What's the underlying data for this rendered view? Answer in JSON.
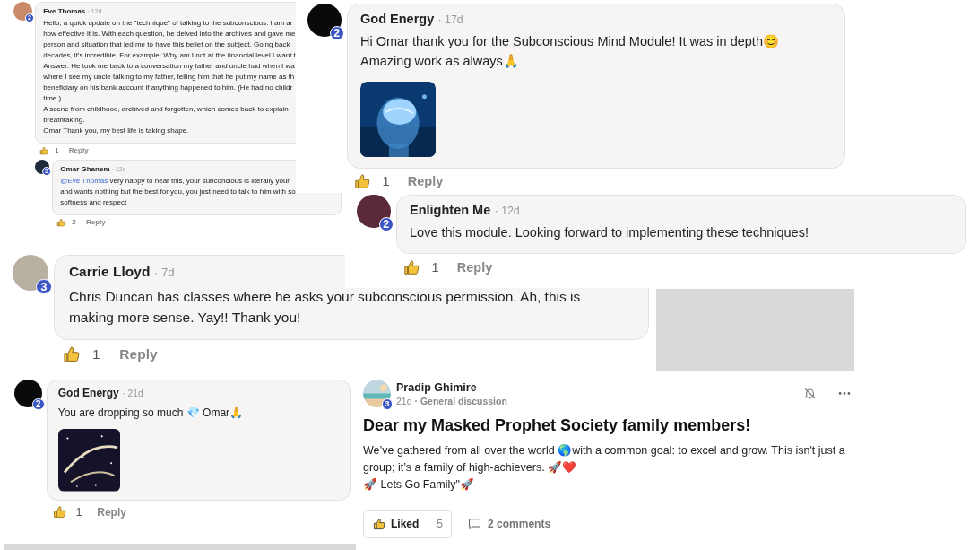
{
  "comments": [
    {
      "author": "Eve Thomas",
      "age": "· 12d",
      "badge": "2",
      "lines": [
        "Hello, a quick update on the \"technique\" of talking to the subconscious. I am ar",
        "how effective it is. With each question, he delved into the archives and gave me",
        "person and situation that led me to have this belief on the subject. Going back",
        "decades, it's incredible. For example: Why am I not at the financial level I want t",
        "Answer: He took me back to a conversation my father and uncle had when I wa",
        "where I see my uncle talking to my father, telling him that he put my name as th",
        "beneficiary on his bank account if anything happened to him. (He had no childr",
        "time.)",
        "A scene from childhood, archived and forgotten, which comes back to explain",
        "breathtaking.",
        "Omar Thank you, my best life is taking shape."
      ],
      "likes": "1",
      "reply": "Reply",
      "replies": [
        {
          "author": "Omar Ghanem",
          "age": "· 12d",
          "badge": "5",
          "mention": "@Eve Thomas",
          "lines": [
            "very happy to hear this, your subconcious is literally your",
            "and wants nothing but the best for you, you just need to talk to him with so",
            "softness and respect"
          ],
          "likes": "2",
          "reply": "Reply"
        }
      ]
    },
    {
      "author": "God Energy",
      "age": "· 17d",
      "badge": "2",
      "lines": [
        "Hi Omar thank you for the Subconscious Mind Module! It was in depth😊",
        "Amazing work as always🙏"
      ],
      "attachment": {
        "kind": "picture"
      },
      "likes": "1",
      "reply": "Reply"
    },
    {
      "author": "Enlighten Me",
      "age": "· 12d",
      "badge": "2",
      "lines": [
        "Love this module. Looking forward to implementing these techniques!"
      ],
      "likes": "1",
      "reply": "Reply"
    },
    {
      "author": "Carrie Lloyd",
      "age": "· 7d",
      "badge": "3",
      "lines": [
        "Chris Duncan has classes where he asks your subconscious permission. Ah, this is",
        "making more sense. Yay!! Thank you!"
      ],
      "likes": "1",
      "reply": "Reply"
    },
    {
      "author": "God Energy",
      "age": "· 21d",
      "badge": "2",
      "lines": [
        "You are dropping so much 💎 Omar🙏"
      ],
      "attachment": {
        "kind": "picture"
      },
      "likes": "1",
      "reply": "Reply"
    }
  ],
  "post": {
    "author": "Pradip Ghimire",
    "badge": "3",
    "age": "21d",
    "category": "· General discussion",
    "title": "Dear my Masked Prophet Society family members!",
    "body": "We’ve gathered from all over the world 🌎with a common goal: to excel and grow. This isn't just a group; it’s a family of high-achievers. 🚀❤️\n🚀 Lets Go Family\"🚀",
    "liked": true,
    "like_label": "Liked",
    "likes": "5",
    "comments_label": "2 comments"
  }
}
